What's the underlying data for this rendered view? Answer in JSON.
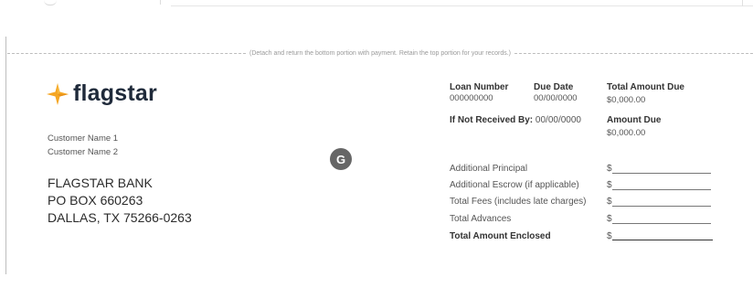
{
  "cut_instruction": "(Detach and return the bottom portion with payment. Retain the top portion for your records.)",
  "logo": {
    "text": "flagstar",
    "icon": "flagstar-logo-icon",
    "accent_color": "#f5a623"
  },
  "customer": {
    "name1": "Customer Name 1",
    "name2": "Customer Name 2"
  },
  "address": {
    "line1": "FLAGSTAR BANK",
    "line2": "PO BOX 660263",
    "line3": "DALLAS, TX 75266-0263"
  },
  "badge": "G",
  "loan": {
    "loan_number_label": "Loan Number",
    "loan_number_value": "000000000",
    "due_date_label": "Due Date",
    "due_date_value": "00/00/0000",
    "total_amount_due_label": "Total Amount Due",
    "total_amount_due_value": "$0,000.00",
    "not_received_label": "If Not Received By:",
    "not_received_value": "00/00/0000",
    "amount_due_label": "Amount Due",
    "amount_due_value": "$0,000.00"
  },
  "payment_rows": [
    {
      "label": "Additional Principal",
      "currency": "$"
    },
    {
      "label": "Additional Escrow (if applicable)",
      "currency": "$"
    },
    {
      "label": "Total Fees (includes late charges)",
      "currency": "$"
    },
    {
      "label": "Total Advances",
      "currency": "$"
    },
    {
      "label": "Total Amount Enclosed",
      "currency": "$"
    }
  ]
}
